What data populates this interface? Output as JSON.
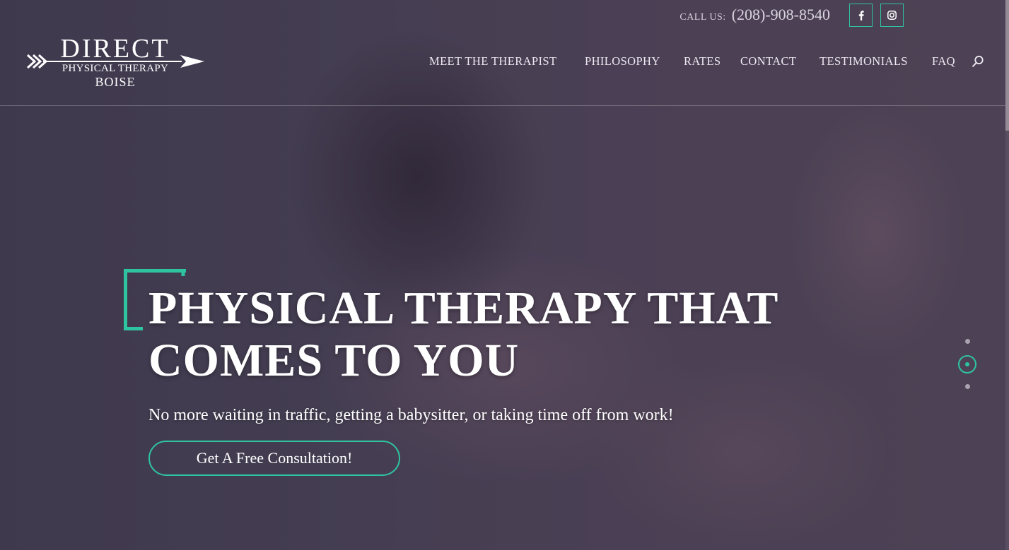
{
  "brand": {
    "name_line1": "DIRECT",
    "name_line2": "PHYSICAL THERAPY",
    "name_line3": "BOISE"
  },
  "topbar": {
    "call_label": "CALL US:",
    "phone": "(208)-908-8540",
    "social": [
      {
        "icon": "facebook-icon"
      },
      {
        "icon": "instagram-icon"
      }
    ]
  },
  "nav": {
    "items": [
      {
        "label": "MEET THE THERAPIST"
      },
      {
        "label": "PHILOSOPHY"
      },
      {
        "label": "RATES"
      },
      {
        "label": "CONTACT"
      },
      {
        "label": "TESTIMONIALS"
      },
      {
        "label": "FAQ"
      }
    ],
    "search_icon": "search-icon"
  },
  "hero": {
    "title_line1": "PHYSICAL THERAPY THAT",
    "title_line2": "COMES TO YOU",
    "subtitle": "No more waiting in traffic, getting a babysitter, or taking time off from work!",
    "cta_label": "Get A Free Consultation!"
  },
  "slider": {
    "slide_count": 3,
    "active_slide": 2
  },
  "colors": {
    "accent": "#2ec4a0",
    "overlay": "#4a4257",
    "text": "#ffffff"
  }
}
